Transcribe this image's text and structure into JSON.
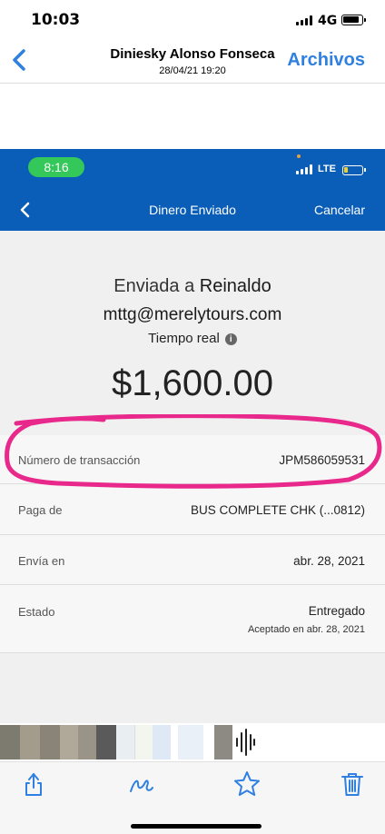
{
  "status_bar": {
    "time": "10:03",
    "network": "4G"
  },
  "nav": {
    "sender_name": "Diniesky Alonso Fonseca",
    "date": "28/04/21 19:20",
    "files_label": "Archivos"
  },
  "inner": {
    "status_time": "8:16",
    "network": "LTE",
    "title": "Dinero Enviado",
    "cancel_label": "Cancelar",
    "sent_prefix": "Enviada a",
    "recipient_name": "Reinaldo",
    "recipient_email": "mttg@merelytours.com",
    "speed": "Tiempo real",
    "amount": "$1,600.00",
    "details": {
      "transaction_label": "Número de transacción",
      "transaction_value": "JPM586059531",
      "pay_from_label": "Paga de",
      "pay_from_value": "BUS COMPLETE CHK (...0812)",
      "send_on_label": "Envía en",
      "send_on_value": "abr. 28, 2021",
      "status_label": "Estado",
      "status_value": "Entregado",
      "status_sub": "Aceptado en abr. 28, 2021"
    }
  },
  "colors": {
    "ios_blue": "#2f80e0",
    "bank_blue": "#0a5eb8",
    "pill_green": "#34c759",
    "highlight_pink": "#e8288a"
  },
  "toolbar": {
    "icons": [
      "share-icon",
      "markup-icon",
      "star-icon",
      "trash-icon"
    ]
  }
}
